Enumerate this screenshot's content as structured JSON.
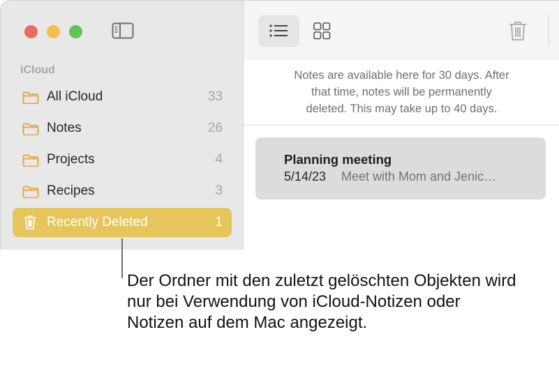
{
  "window": {
    "traffic_lights": [
      "close",
      "minimize",
      "zoom"
    ]
  },
  "sidebar": {
    "toggle_icon": "sidebar-toggle-icon",
    "section_label": "iCloud",
    "items": [
      {
        "label": "All iCloud",
        "count": "33",
        "icon": "folder-icon",
        "selected": false
      },
      {
        "label": "Notes",
        "count": "26",
        "icon": "folder-icon",
        "selected": false
      },
      {
        "label": "Projects",
        "count": "4",
        "icon": "folder-icon",
        "selected": false
      },
      {
        "label": "Recipes",
        "count": "3",
        "icon": "folder-icon",
        "selected": false
      },
      {
        "label": "Recently Deleted",
        "count": "1",
        "icon": "trash-icon",
        "selected": true
      }
    ],
    "accent_color": "#e6c65c",
    "folder_color": "#e5a33a"
  },
  "toolbar": {
    "list_view_icon": "list-view-icon",
    "gallery_view_icon": "gallery-view-icon",
    "delete_icon": "trash-icon"
  },
  "main": {
    "info_text_lines": [
      "Notes are available here for 30 days. After",
      "that time, notes will be permanently",
      "deleted. This may take up to 40 days."
    ],
    "notes": [
      {
        "title": "Planning meeting",
        "date": "5/14/23",
        "preview": "Meet with Mom and Jenic…"
      }
    ]
  },
  "callout": {
    "text": "Der Ordner mit den zuletzt gelöschten Objekten wird nur bei Verwendung von iCloud-Notizen oder Notizen auf dem Mac angezeigt."
  }
}
